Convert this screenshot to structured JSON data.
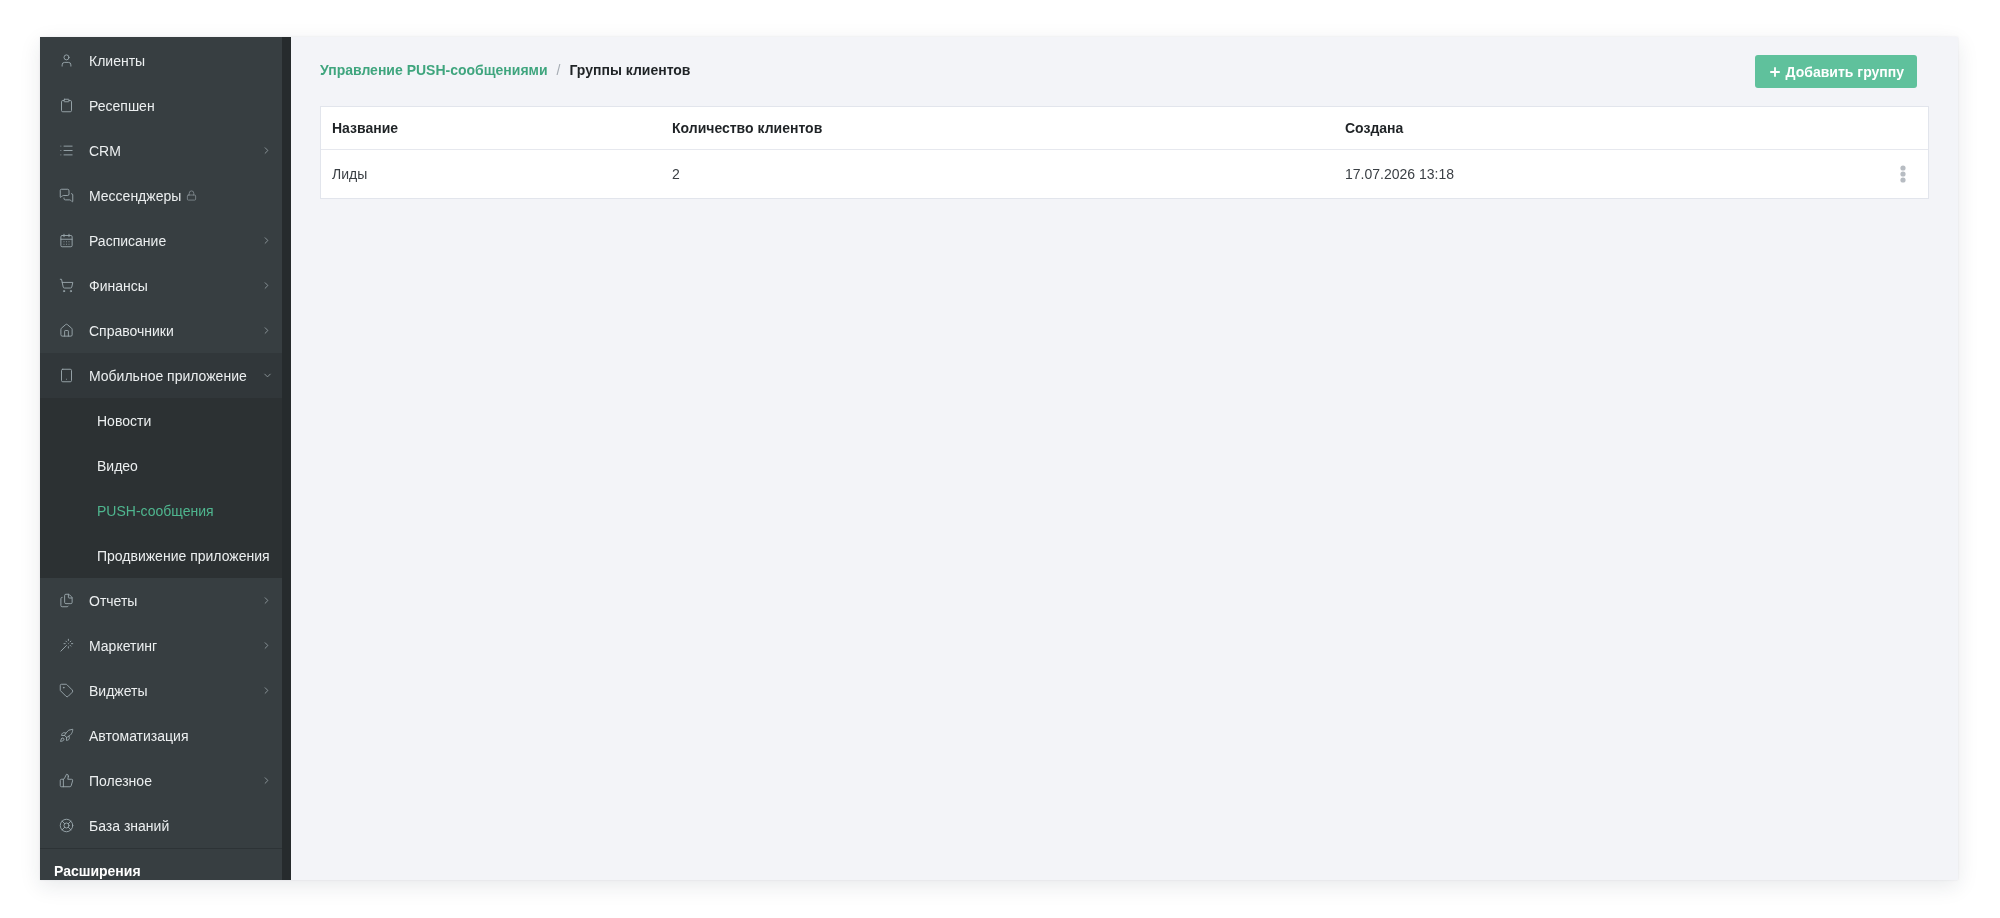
{
  "sidebar": {
    "items": [
      {
        "label": "Клиенты",
        "kind": "link",
        "locked": false
      },
      {
        "label": "Ресепшен",
        "kind": "link",
        "locked": false
      },
      {
        "label": "CRM",
        "kind": "group",
        "expanded": false,
        "locked": false
      },
      {
        "label": "Мессенджеры",
        "kind": "link",
        "locked": true
      },
      {
        "label": "Расписание",
        "kind": "group",
        "expanded": false,
        "locked": false
      },
      {
        "label": "Финансы",
        "kind": "group",
        "expanded": false,
        "locked": false
      },
      {
        "label": "Справочники",
        "kind": "group",
        "expanded": false,
        "locked": false
      },
      {
        "label": "Мобильное приложение",
        "kind": "group",
        "expanded": true,
        "locked": false,
        "children": [
          {
            "label": "Новости",
            "selected": false
          },
          {
            "label": "Видео",
            "selected": false
          },
          {
            "label": "PUSH-сообщения",
            "selected": true
          },
          {
            "label": "Продвижение приложения",
            "selected": false
          }
        ]
      },
      {
        "label": "Отчеты",
        "kind": "group",
        "expanded": false,
        "locked": false
      },
      {
        "label": "Маркетинг",
        "kind": "group",
        "expanded": false,
        "locked": false
      },
      {
        "label": "Виджеты",
        "kind": "group",
        "expanded": false,
        "locked": false
      },
      {
        "label": "Автоматизация",
        "kind": "link",
        "locked": false
      },
      {
        "label": "Полезное",
        "kind": "group",
        "expanded": false,
        "locked": false
      },
      {
        "label": "База знаний",
        "kind": "link",
        "locked": false
      }
    ],
    "section_title": "Расширения"
  },
  "breadcrumb": {
    "items": [
      {
        "label": "Управление PUSH-сообщениями",
        "kind": "link"
      },
      {
        "label": "Группы клиентов",
        "kind": "current"
      }
    ],
    "separator": "/"
  },
  "add_button": {
    "label": "Добавить группу"
  },
  "table": {
    "columns": [
      "Название",
      "Количество клиентов",
      "Создана"
    ],
    "rows": [
      {
        "cells": [
          "Лиды",
          "2",
          "17.07.2026 13:18"
        ]
      }
    ]
  }
}
